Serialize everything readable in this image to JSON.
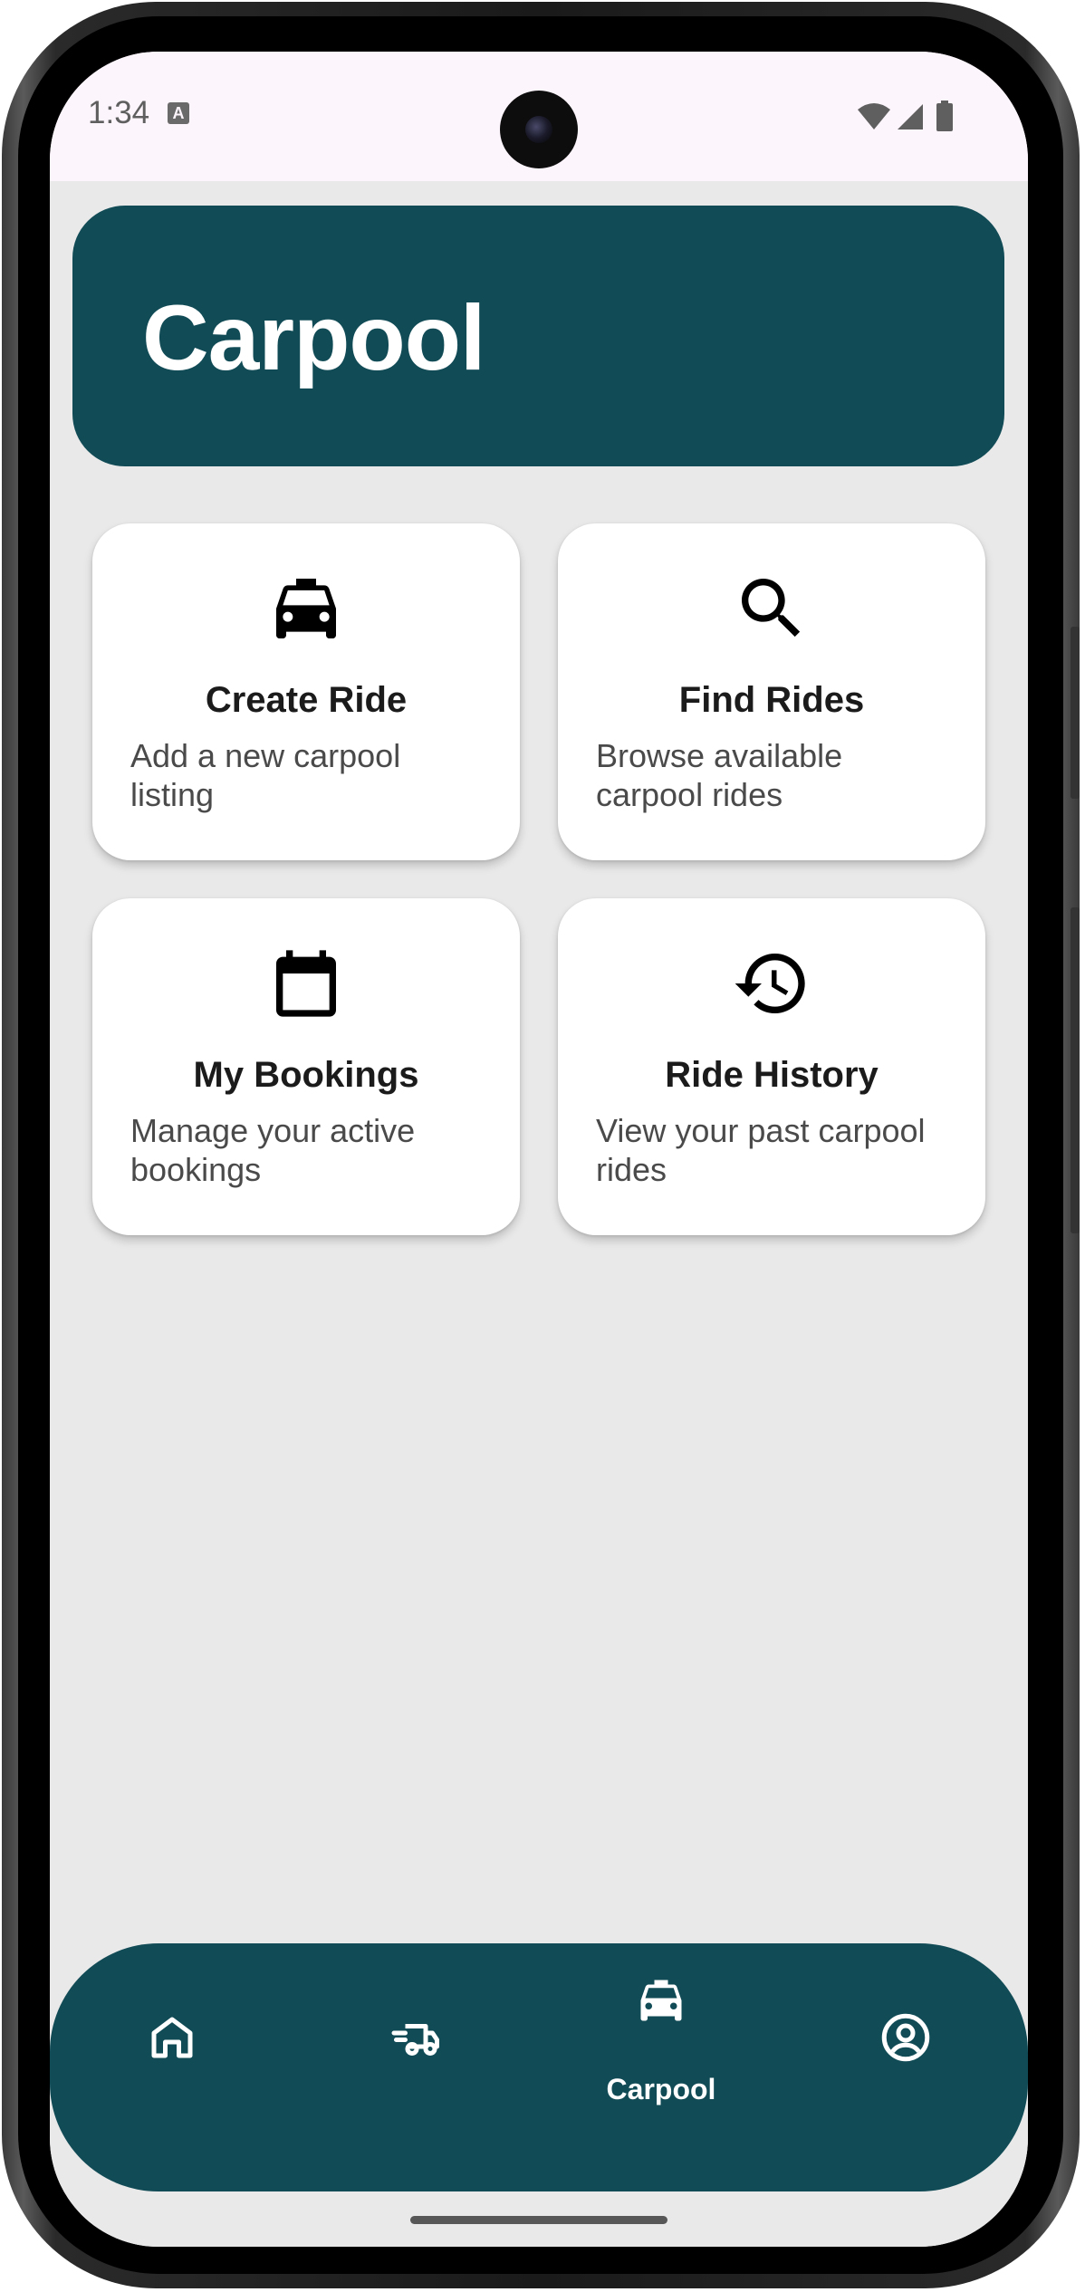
{
  "status_bar": {
    "time": "1:34",
    "notification_icon": "a-icon",
    "icons": [
      "wifi-icon",
      "signal-icon",
      "battery-icon"
    ]
  },
  "header": {
    "title": "Carpool"
  },
  "tiles": [
    {
      "icon": "taxi-icon",
      "title": "Create Ride",
      "description": "Add a new carpool listing"
    },
    {
      "icon": "search-icon",
      "title": "Find Rides",
      "description": "Browse available carpool rides"
    },
    {
      "icon": "calendar-icon",
      "title": "My Bookings",
      "description": "Manage your active bookings"
    },
    {
      "icon": "history-icon",
      "title": "Ride History",
      "description": "View your past carpool rides"
    }
  ],
  "bottom_nav": {
    "items": [
      {
        "icon": "home-icon",
        "label": ""
      },
      {
        "icon": "delivery-truck-icon",
        "label": ""
      },
      {
        "icon": "taxi-icon",
        "label": "Carpool",
        "selected": true
      },
      {
        "icon": "account-circle-icon",
        "label": ""
      }
    ]
  },
  "colors": {
    "primary": "#114b56",
    "background": "#e9e9e9",
    "card": "#ffffff",
    "status_bar": "#fdf5fc"
  }
}
